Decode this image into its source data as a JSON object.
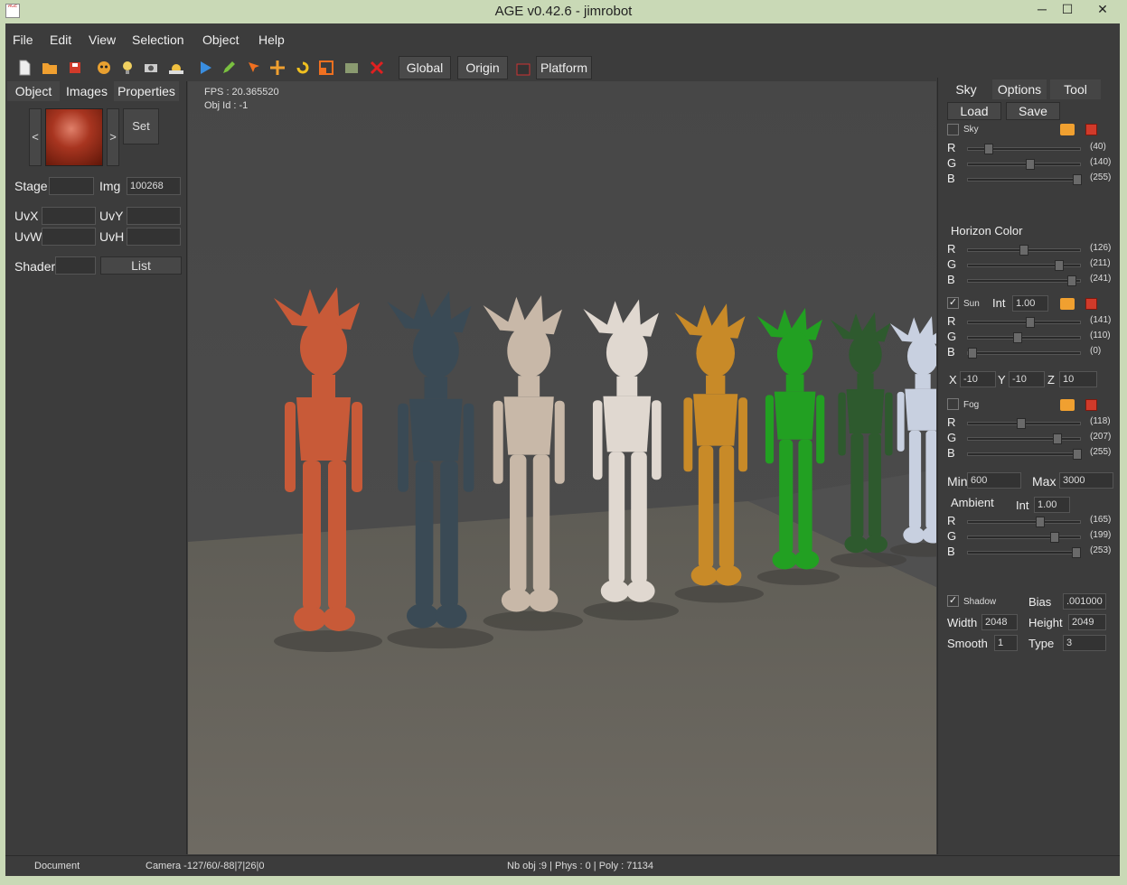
{
  "window": {
    "title": "AGE v0.42.6 - jimrobot",
    "icon_text": "AGE",
    "minimize": "─",
    "maximize": "☐",
    "close": "✕"
  },
  "menu": [
    "File",
    "Edit",
    "View",
    "Selection",
    "Object",
    "Help"
  ],
  "toolbar": {
    "global_label": "Global",
    "origin_label": "Origin",
    "platform_label": "Platform"
  },
  "left_panel": {
    "tabs": [
      "Object",
      "Images",
      "Properties"
    ],
    "prev": "<",
    "next": ">",
    "set": "Set",
    "stage_label": "Stage",
    "stage_value": "",
    "img_label": "Img",
    "img_value": "100268",
    "uvx_label": "UvX",
    "uvy_label": "UvY",
    "uvw_label": "UvW",
    "uvh_label": "UvH",
    "shader_label": "Shader",
    "list_label": "List"
  },
  "viewport": {
    "fps": "FPS : 20.365520",
    "obj_id": "Obj Id : -1",
    "robot_colors": [
      "#c85a38",
      "#3a4a55",
      "#c8b8a8",
      "#e0d8d0",
      "#c88a28",
      "#22a022",
      "#2e5a2e",
      "#c8d0e0"
    ]
  },
  "right_panel": {
    "tabs": [
      "Sky",
      "Options",
      "Tool"
    ],
    "load": "Load",
    "save": "Save",
    "sky": {
      "label": "Sky",
      "checked": false,
      "r": 40,
      "g": 140,
      "b": 255,
      "r_text": "(40)",
      "g_text": "(140)",
      "b_text": "(255)"
    },
    "horizon": {
      "label": "Horizon Color",
      "r": 126,
      "g": 211,
      "b": 241,
      "r_text": "(126)",
      "g_text": "(211)",
      "b_text": "(241)"
    },
    "sun": {
      "label": "Sun",
      "checked": true,
      "int_label": "Int",
      "int_value": "1.00",
      "r": 141,
      "g": 110,
      "b": 0,
      "r_text": "(141)",
      "g_text": "(110)",
      "b_text": "(0)"
    },
    "pos": {
      "x_label": "X",
      "x": "-10",
      "y_label": "Y",
      "y": "-10",
      "z_label": "Z",
      "z": "10"
    },
    "fog": {
      "label": "Fog",
      "checked": false,
      "r": 118,
      "g": 207,
      "b": 255,
      "r_text": "(118)",
      "g_text": "(207)",
      "b_text": "(255)"
    },
    "min_label": "Min",
    "min": "600",
    "max_label": "Max",
    "max": "3000",
    "ambient": {
      "label": "Ambient",
      "int_label": "Int",
      "int_value": "1.00",
      "r": 165,
      "g": 199,
      "b": 253,
      "r_text": "(165)",
      "g_text": "(199)",
      "b_text": "(253)"
    },
    "shadow": {
      "label": "Shadow",
      "checked": true,
      "bias_label": "Bias",
      "bias": ".001000",
      "width_label": "Width",
      "width": "2048",
      "height_label": "Height",
      "height": "2049",
      "smooth_label": "Smooth",
      "smooth": "1",
      "type_label": "Type",
      "type": "3"
    },
    "r": "R",
    "g": "G",
    "b": "B",
    "checkmark": "✓"
  },
  "status": {
    "document": "Document",
    "camera": "Camera -127/60/-88|7|26|0",
    "stats": "Nb obj :9 | Phys : 0 | Poly : 71134"
  }
}
